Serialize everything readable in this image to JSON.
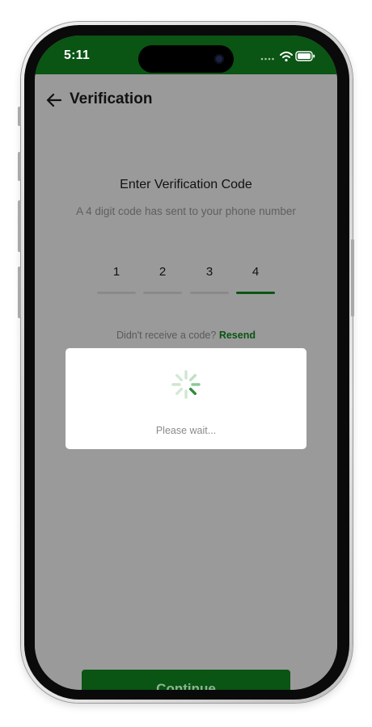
{
  "status_bar": {
    "time": "5:11",
    "icons": [
      "cellular-dots-icon",
      "wifi-icon",
      "battery-icon"
    ]
  },
  "nav": {
    "back_icon": "back-arrow-icon",
    "title": "Verification"
  },
  "verification": {
    "heading": "Enter Verification Code",
    "subtext": "A 4 digit code has sent to your phone number",
    "digits": [
      "1",
      "2",
      "3",
      "4"
    ],
    "active_index": 3
  },
  "resend": {
    "prompt": "Didn't receive a code?",
    "link": "Resend"
  },
  "loading": {
    "icon": "spinner-icon",
    "text": "Please wait..."
  },
  "continue_button": {
    "label": "Continue"
  },
  "colors": {
    "brand_green": "#0a5414",
    "overlay_gray": "#9a9a9a",
    "spinner_green": "#2e8b3a"
  }
}
